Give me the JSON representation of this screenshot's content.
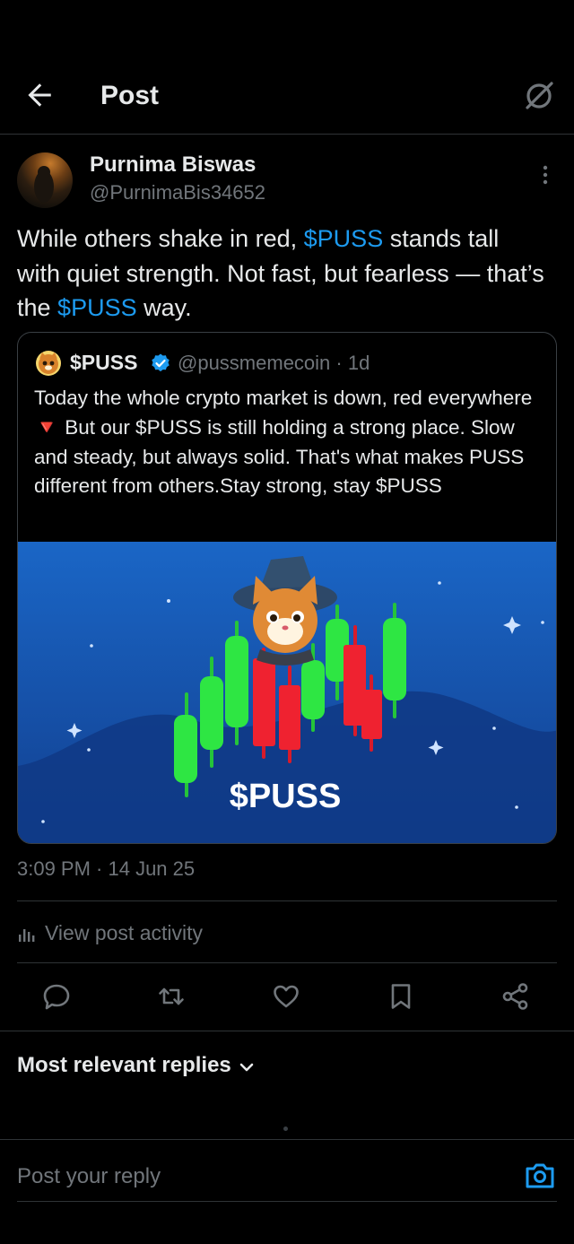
{
  "header": {
    "title": "Post",
    "back_icon": "arrow-left-icon",
    "grok_icon": "grok-icon"
  },
  "post": {
    "author_name": "Purnima Biswas",
    "author_handle": "@PurnimaBis34652",
    "text_part1": "While others shake in red, ",
    "cashtag1": "$PUSS",
    "text_part2": " stands tall with quiet strength. Not fast, but fearless — that’s the ",
    "cashtag2": "$PUSS",
    "text_part3": " way.",
    "timestamp": "3:09 PM · 14 Jun 25"
  },
  "quote": {
    "name": "$PUSS",
    "handle_time": "@pussmemecoin · 1d",
    "text_part1": "Today the whole crypto market is down, red everywhere ",
    "emoji": "🔻",
    "text_part2": " But our $PUSS is still holding a strong place. Slow and steady, but always solid. That's what makes PUSS different from others.Stay strong, stay $PUSS",
    "image_caption": "$PUSS"
  },
  "activity_label": "View post activity",
  "actions": [
    "reply-icon",
    "repost-icon",
    "like-icon",
    "bookmark-icon",
    "share-icon"
  ],
  "replies": {
    "sort_label": "Most relevant replies"
  },
  "composer": {
    "placeholder": "Post your reply"
  },
  "colors": {
    "accent": "#1d9bf0",
    "background": "#000000",
    "muted": "#71767b",
    "image_bg": "#1758b3"
  }
}
